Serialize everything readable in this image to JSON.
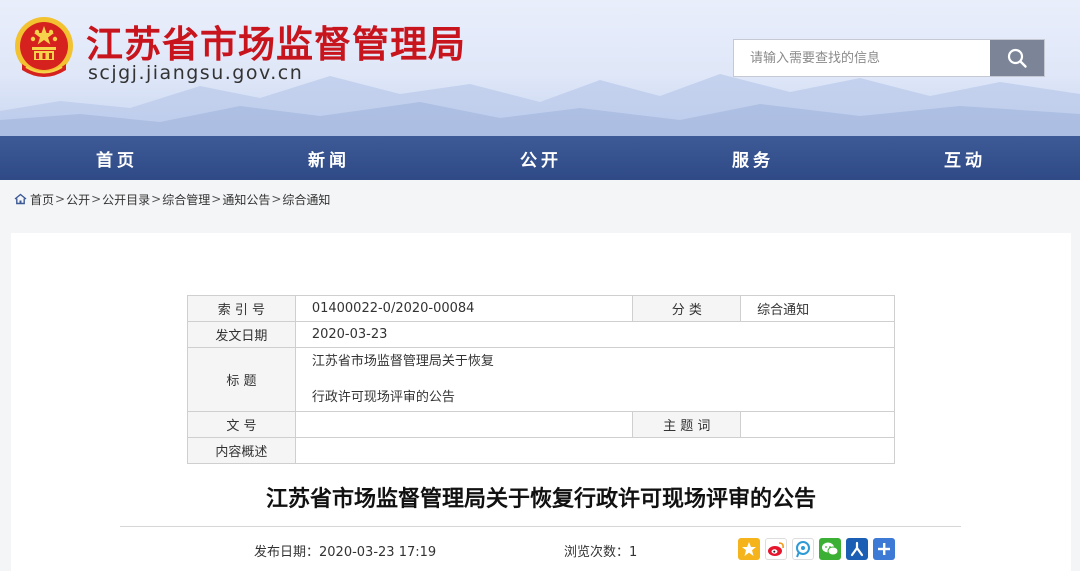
{
  "header": {
    "site_title": "江苏省市场监督管理局",
    "site_domain": "scjgj.jiangsu.gov.cn",
    "search_placeholder": "请输入需要查找的信息"
  },
  "nav": {
    "items": [
      {
        "label": "首页"
      },
      {
        "label": "新闻"
      },
      {
        "label": "公开"
      },
      {
        "label": "服务"
      },
      {
        "label": "互动"
      }
    ]
  },
  "breadcrumb": {
    "items": [
      "首页",
      "公开",
      "公开目录",
      "综合管理",
      "通知公告",
      "综合通知"
    ],
    "separator": ">"
  },
  "meta": {
    "index_label": "索 引 号",
    "index_value": "01400022-0/2020-00084",
    "category_label": "分 类",
    "category_value": "综合通知",
    "date_label": "发文日期",
    "date_value": "2020-03-23",
    "title_label": "标 题",
    "title_line1": "江苏省市场监督管理局关于恢复",
    "title_line2": "行政许可现场评审的公告",
    "docno_label": "文 号",
    "docno_value": "",
    "subject_label": "主 题 词",
    "subject_value": "",
    "summary_label": "内容概述",
    "summary_value": ""
  },
  "article": {
    "title": "江苏省市场监督管理局关于恢复行政许可现场评审的公告",
    "publish_label": "发布日期：",
    "publish_value": "2020-03-23 17:19",
    "views_label": "浏览次数：",
    "views_value": "1"
  },
  "share": {
    "icons": [
      "qzone-icon",
      "weibo-icon",
      "tencent-weibo-icon",
      "wechat-icon",
      "renren-icon",
      "more-share-icon"
    ],
    "colors": {
      "qzone": "#f5b31c",
      "weibo": "#e6162d",
      "tencent": "#2f9bd6",
      "wechat": "#3cb034",
      "renren": "#1b5fb4",
      "more": "#3d7ad6"
    }
  },
  "colors": {
    "title_red": "#c8151d",
    "nav_blue": "#2f4a86"
  }
}
